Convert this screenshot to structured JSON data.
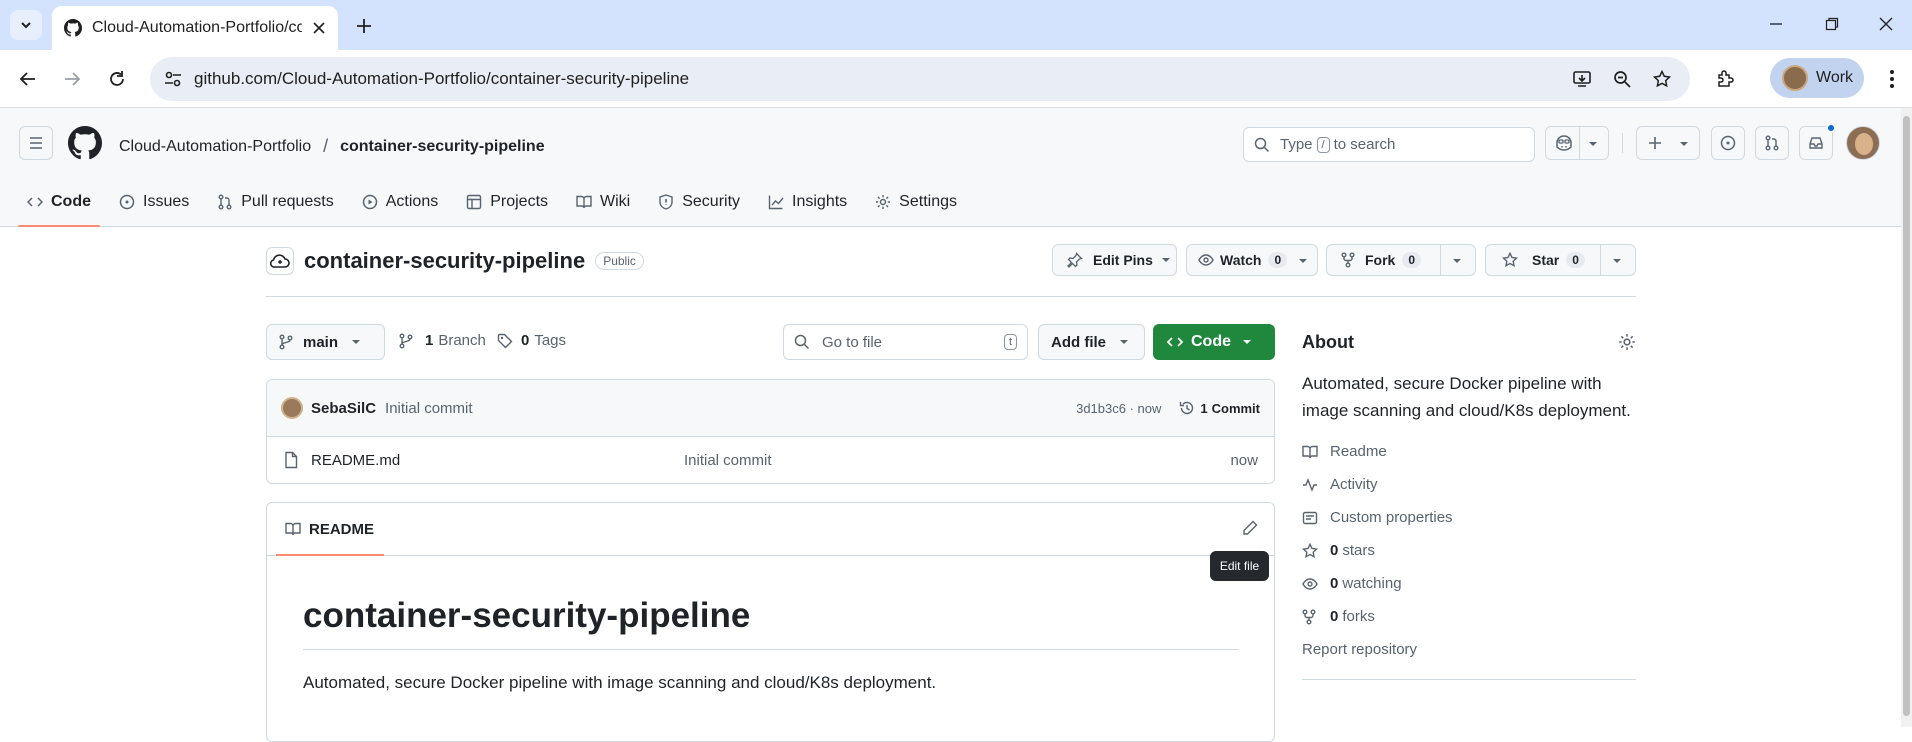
{
  "browser": {
    "tab_title": "Cloud-Automation-Portfolio/co",
    "url": "github.com/Cloud-Automation-Portfolio/container-security-pipeline",
    "profile_label": "Work"
  },
  "header": {
    "owner": "Cloud-Automation-Portfolio",
    "separator": "/",
    "repo": "container-security-pipeline",
    "search_pre": "Type",
    "search_key": "/",
    "search_post": "to search"
  },
  "nav": {
    "tabs": [
      {
        "label": "Code"
      },
      {
        "label": "Issues"
      },
      {
        "label": "Pull requests"
      },
      {
        "label": "Actions"
      },
      {
        "label": "Projects"
      },
      {
        "label": "Wiki"
      },
      {
        "label": "Security"
      },
      {
        "label": "Insights"
      },
      {
        "label": "Settings"
      }
    ]
  },
  "repo": {
    "name": "container-security-pipeline",
    "visibility": "Public",
    "edit_pins": "Edit Pins",
    "watch": "Watch",
    "watch_count": "0",
    "fork": "Fork",
    "fork_count": "0",
    "star": "Star",
    "star_count": "0"
  },
  "filenav": {
    "branch": "main",
    "branches_count": "1",
    "branches_label": "Branch",
    "tags_count": "0",
    "tags_label": "Tags",
    "go_to_file": "Go to file",
    "go_to_file_key": "t",
    "add_file": "Add file",
    "code": "Code"
  },
  "commit": {
    "author": "SebaSilC",
    "message": "Initial commit",
    "hash_time": "3d1b3c6 · now",
    "commits_count": "1",
    "commits_label": "Commit"
  },
  "files": [
    {
      "name": "README.md",
      "message": "Initial commit",
      "time": "now"
    }
  ],
  "readme": {
    "tab_label": "README",
    "heading": "container-security-pipeline",
    "paragraph": "Automated, secure Docker pipeline with image scanning and cloud/K8s deployment.",
    "tooltip": "Edit file"
  },
  "about": {
    "title": "About",
    "description": "Automated, secure Docker pipeline with image scanning and cloud/K8s deployment.",
    "readme": "Readme",
    "activity": "Activity",
    "custom_properties": "Custom properties",
    "stars_count": "0",
    "stars_label": "stars",
    "watching_count": "0",
    "watching_label": "watching",
    "forks_count": "0",
    "forks_label": "forks",
    "report": "Report repository"
  },
  "colors": {
    "accent_green": "#1f883d",
    "tab_underline": "#fd8c73",
    "notification_dot": "#0969da"
  }
}
